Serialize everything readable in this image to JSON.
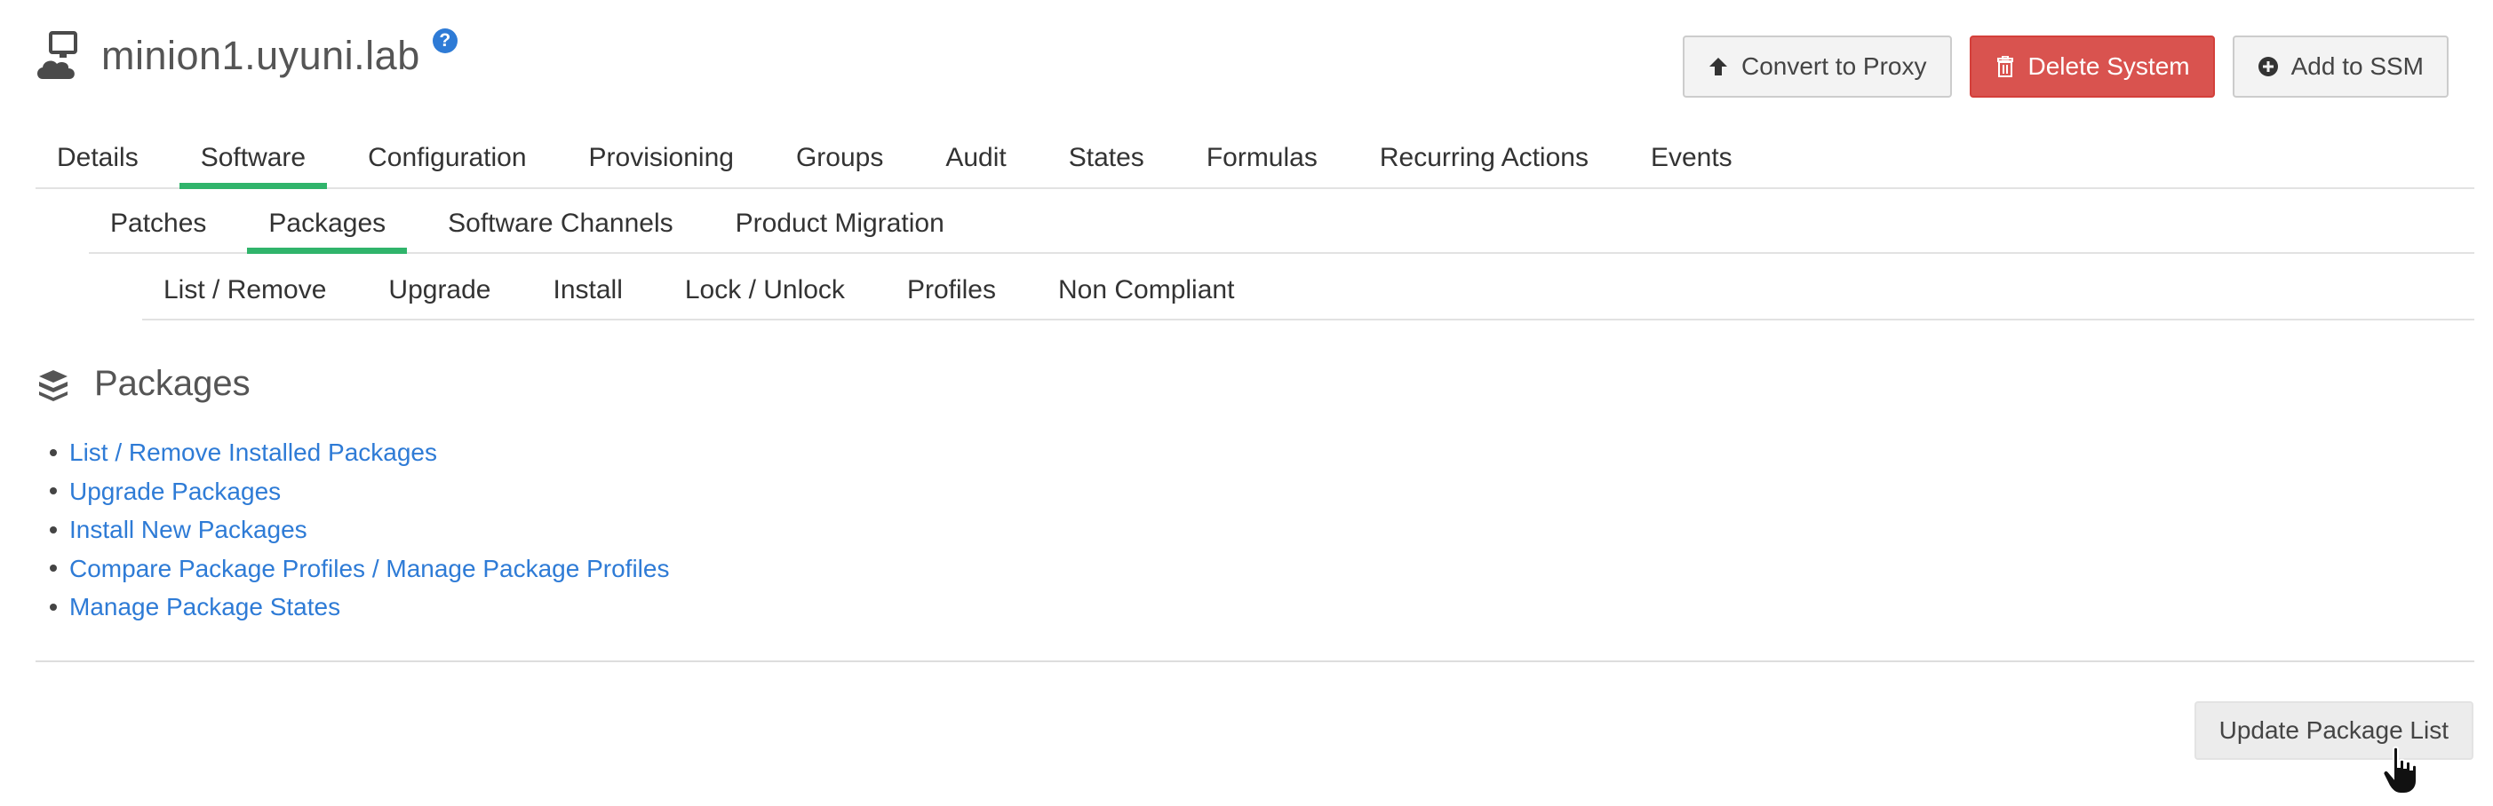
{
  "header": {
    "system_name": "minion1.uyuni.lab",
    "help_icon": "?",
    "icons": {
      "system": "computer-cloud-icon",
      "help": "question-circle-icon"
    }
  },
  "actions": {
    "convert_label": "Convert to Proxy",
    "delete_label": "Delete System",
    "ssm_label": "Add to SSM",
    "colors": {
      "danger": "#d9534f"
    }
  },
  "tabs_main": [
    {
      "label": "Details"
    },
    {
      "label": "Software"
    },
    {
      "label": "Configuration"
    },
    {
      "label": "Provisioning"
    },
    {
      "label": "Groups"
    },
    {
      "label": "Audit"
    },
    {
      "label": "States"
    },
    {
      "label": "Formulas"
    },
    {
      "label": "Recurring Actions"
    },
    {
      "label": "Events"
    }
  ],
  "tabs_software": [
    {
      "label": "Patches"
    },
    {
      "label": "Packages"
    },
    {
      "label": "Software Channels"
    },
    {
      "label": "Product Migration"
    }
  ],
  "tabs_packages": [
    {
      "label": "List / Remove"
    },
    {
      "label": "Upgrade"
    },
    {
      "label": "Install"
    },
    {
      "label": "Lock / Unlock"
    },
    {
      "label": "Profiles"
    },
    {
      "label": "Non Compliant"
    }
  ],
  "section": {
    "title": "Packages",
    "icon": "packages-icon",
    "links": [
      {
        "label": "List / Remove Installed Packages"
      },
      {
        "label": "Upgrade Packages"
      },
      {
        "label": "Install New Packages"
      },
      {
        "label": "Compare Package Profiles / Manage Package Profiles"
      },
      {
        "label": "Manage Package States"
      }
    ]
  },
  "footer": {
    "update_label": "Update Package List"
  },
  "theme": {
    "active_tab": "#30b46b",
    "link": "#2e7bd6"
  }
}
